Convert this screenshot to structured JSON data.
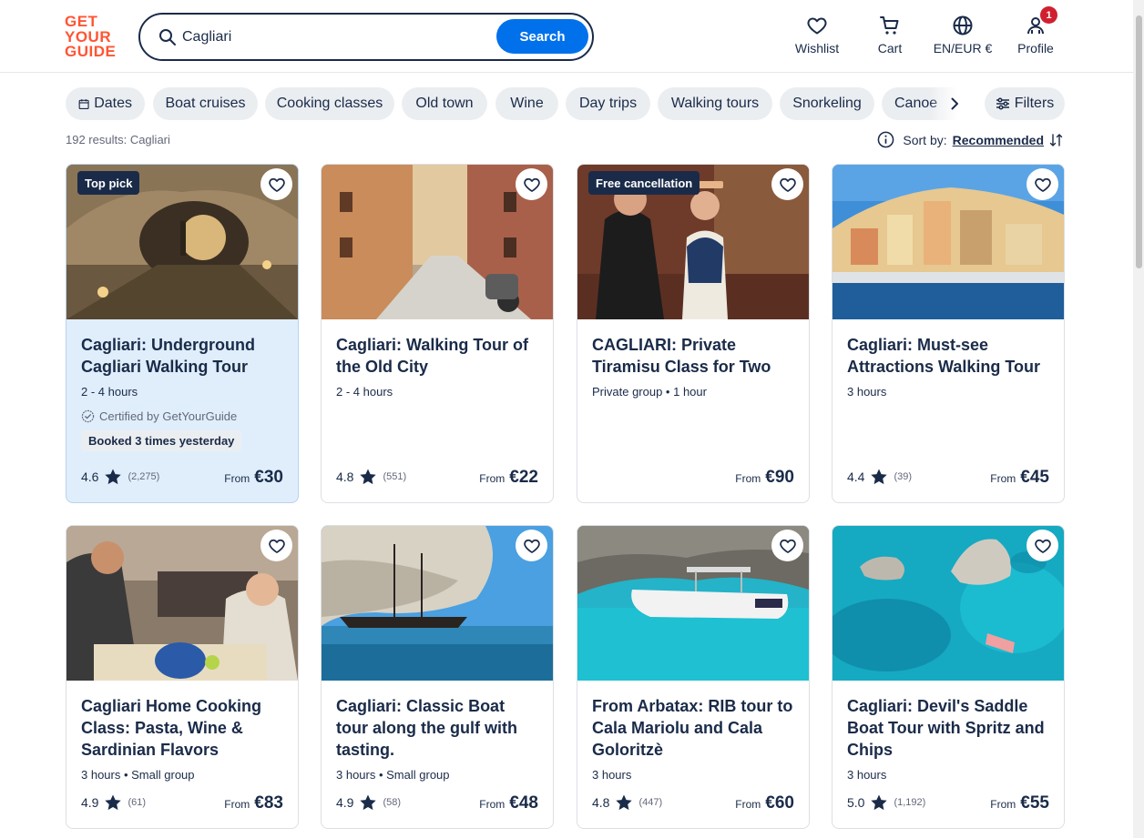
{
  "header": {
    "logo_lines": [
      "GET",
      "YOUR",
      "GUIDE"
    ],
    "search": {
      "value": "Cagliari",
      "button_label": "Search"
    },
    "nav": {
      "wishlist": "Wishlist",
      "cart": "Cart",
      "language": "EN/EUR €",
      "profile": "Profile",
      "profile_badge": "1"
    }
  },
  "filters": {
    "chips": [
      "Dates",
      "Boat cruises",
      "Cooking classes",
      "Old town",
      "Wine",
      "Day trips",
      "Walking tours",
      "Snorkeling",
      "Canoe"
    ],
    "filters_label": "Filters"
  },
  "results": {
    "count_text": "192 results: Cagliari",
    "sort_label": "Sort by:",
    "sort_value": "Recommended"
  },
  "cards": [
    {
      "title": "Cagliari: Underground Cagliari Walking Tour",
      "badge": "Top pick",
      "meta": "2 - 4 hours",
      "certified": "Certified by GetYourGuide",
      "booked": "Booked 3 times yesterday",
      "rating": "4.6",
      "reviews": "(2,275)",
      "from": "From",
      "price": "€30",
      "image": "underground-cave"
    },
    {
      "title": "Cagliari: Walking Tour of the Old City",
      "badge": "",
      "meta": "2 - 4 hours",
      "rating": "4.8",
      "reviews": "(551)",
      "from": "From",
      "price": "€22",
      "image": "old-city-street"
    },
    {
      "title": "CAGLIARI: Private Tiramisu Class for Two",
      "badge": "Free cancellation",
      "meta": "Private group • 1 hour",
      "rating": "",
      "reviews": "",
      "from": "From",
      "price": "€90",
      "image": "tiramisu-couple"
    },
    {
      "title": "Cagliari: Must-see Attractions Walking Tour",
      "badge": "",
      "meta": "3 hours",
      "rating": "4.4",
      "reviews": "(39)",
      "from": "From",
      "price": "€45",
      "image": "city-harbor"
    },
    {
      "title": "Cagliari Home Cooking Class: Pasta, Wine & Sardinian Flavors",
      "badge": "",
      "meta": "3 hours • Small group",
      "rating": "4.9",
      "reviews": "(61)",
      "from": "From",
      "price": "€83",
      "image": "cooking-class"
    },
    {
      "title": "Cagliari: Classic Boat tour along the gulf with tasting.",
      "badge": "",
      "meta": "3 hours • Small group",
      "rating": "4.9",
      "reviews": "(58)",
      "from": "From",
      "price": "€48",
      "image": "sailboat-cliffs"
    },
    {
      "title": "From Arbatax: RIB tour to Cala Mariolu and Cala Goloritzè",
      "badge": "",
      "meta": "3 hours",
      "rating": "4.8",
      "reviews": "(447)",
      "from": "From",
      "price": "€60",
      "image": "rib-boat"
    },
    {
      "title": "Cagliari: Devil's Saddle Boat Tour with Spritz and Chips",
      "badge": "",
      "meta": "3 hours",
      "rating": "5.0",
      "reviews": "(1,192)",
      "from": "From",
      "price": "€55",
      "image": "turquoise-sea"
    }
  ],
  "colors": {
    "brand": "#ff5533",
    "primary": "#0071eb",
    "navy": "#1a2b49",
    "highlight": "#e0eefc",
    "badge_red": "#d0202f"
  }
}
